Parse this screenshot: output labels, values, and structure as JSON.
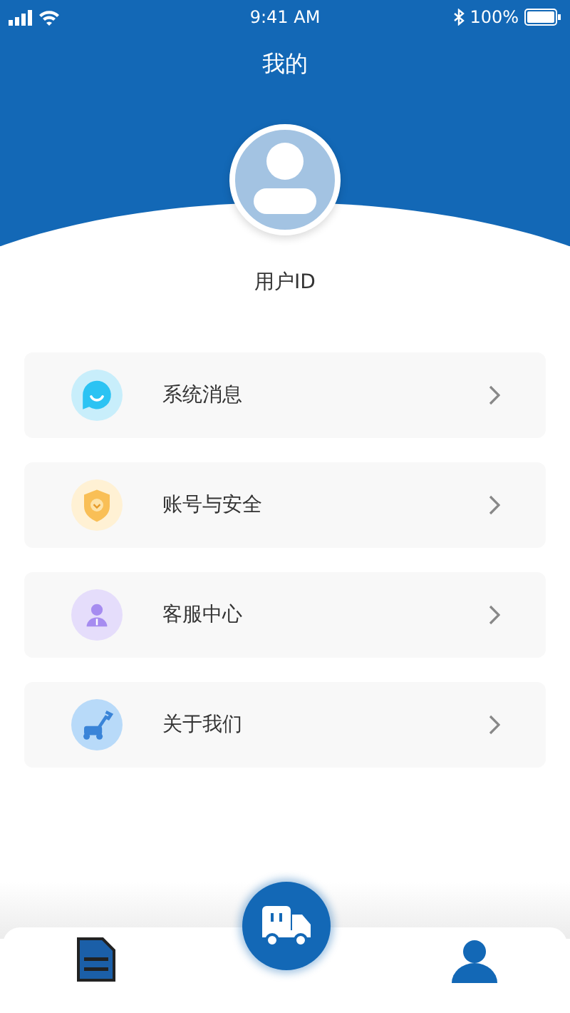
{
  "status_bar": {
    "time": "9:41 AM",
    "battery": "100%"
  },
  "title": "我的",
  "profile": {
    "user_id": "用户ID"
  },
  "menu": [
    {
      "kind": "message",
      "label": "系统消息"
    },
    {
      "kind": "security",
      "label": "账号与安全"
    },
    {
      "kind": "service",
      "label": "客服中心"
    },
    {
      "kind": "about",
      "label": "关于我们"
    }
  ],
  "tab_bar": [
    {
      "kind": "orders",
      "selected": false
    },
    {
      "kind": "delivery",
      "selected": false
    },
    {
      "kind": "profile",
      "selected": true
    }
  ]
}
